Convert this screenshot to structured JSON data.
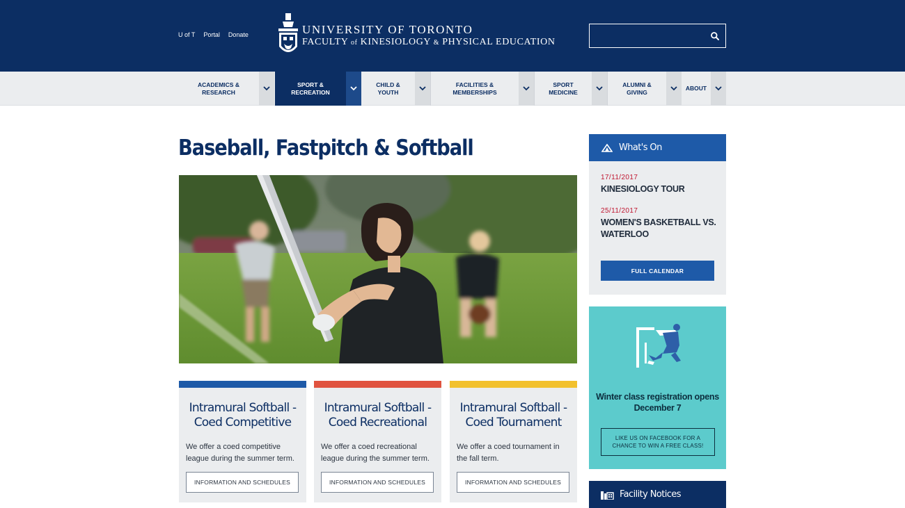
{
  "header": {
    "utility_links": [
      "U of T",
      "Portal",
      "Donate"
    ],
    "logo_line1": "UNIVERSITY OF TORONTO",
    "logo_line2_a": "FACULTY ",
    "logo_line2_of": "of",
    "logo_line2_b": " KINESIOLOGY ",
    "logo_line2_amp": "&",
    "logo_line2_c": " PHYSICAL EDUCATION",
    "search_placeholder": "",
    "colors": {
      "background": "#0c2e63"
    }
  },
  "nav": {
    "items": [
      {
        "label": "ACADEMICS & RESEARCH",
        "active": false
      },
      {
        "label": "SPORT & RECREATION",
        "active": true
      },
      {
        "label": "CHILD & YOUTH",
        "active": false
      },
      {
        "label": "FACILITIES & MEMBERSHIPS",
        "active": false
      },
      {
        "label": "SPORT MEDICINE",
        "active": false
      },
      {
        "label": "ALUMNI & GIVING",
        "active": false
      },
      {
        "label": "ABOUT",
        "active": false
      }
    ]
  },
  "main": {
    "title": "Baseball, Fastpitch & Softball",
    "hero_icon": "photo-softball-batter",
    "cards": [
      {
        "title": "Intramural Softball - Coed Competitive",
        "text": "We offer a coed competitive league during the summer term.",
        "button": "INFORMATION AND SCHEDULES",
        "accent": "#1e5aa8"
      },
      {
        "title": "Intramural Softball - Coed Recreational",
        "text": "We offer a coed recreational league during the summer term.",
        "button": "INFORMATION AND SCHEDULES",
        "accent": "#e0533f"
      },
      {
        "title": "Intramural Softball - Coed Tournament",
        "text": "We offer a coed tournament in the fall term.",
        "button": "INFORMATION AND SCHEDULES",
        "accent": "#f2c12e"
      }
    ]
  },
  "sidebar": {
    "whats_on": {
      "title": "What's On",
      "events": [
        {
          "date": "17/11/2017",
          "title": "KINESIOLOGY TOUR"
        },
        {
          "date": "25/11/2017",
          "title": "WOMEN'S BASKETBALL VS. WATERLOO"
        }
      ],
      "button": "FULL CALENDAR"
    },
    "promo": {
      "heading": "Winter class registration opens December 7",
      "button": "LIKE US ON FACEBOOK FOR A CHANCE TO WIN A FREE CLASS!",
      "background": "#5ccbcc"
    },
    "notices": {
      "title": "Facility Notices"
    }
  }
}
